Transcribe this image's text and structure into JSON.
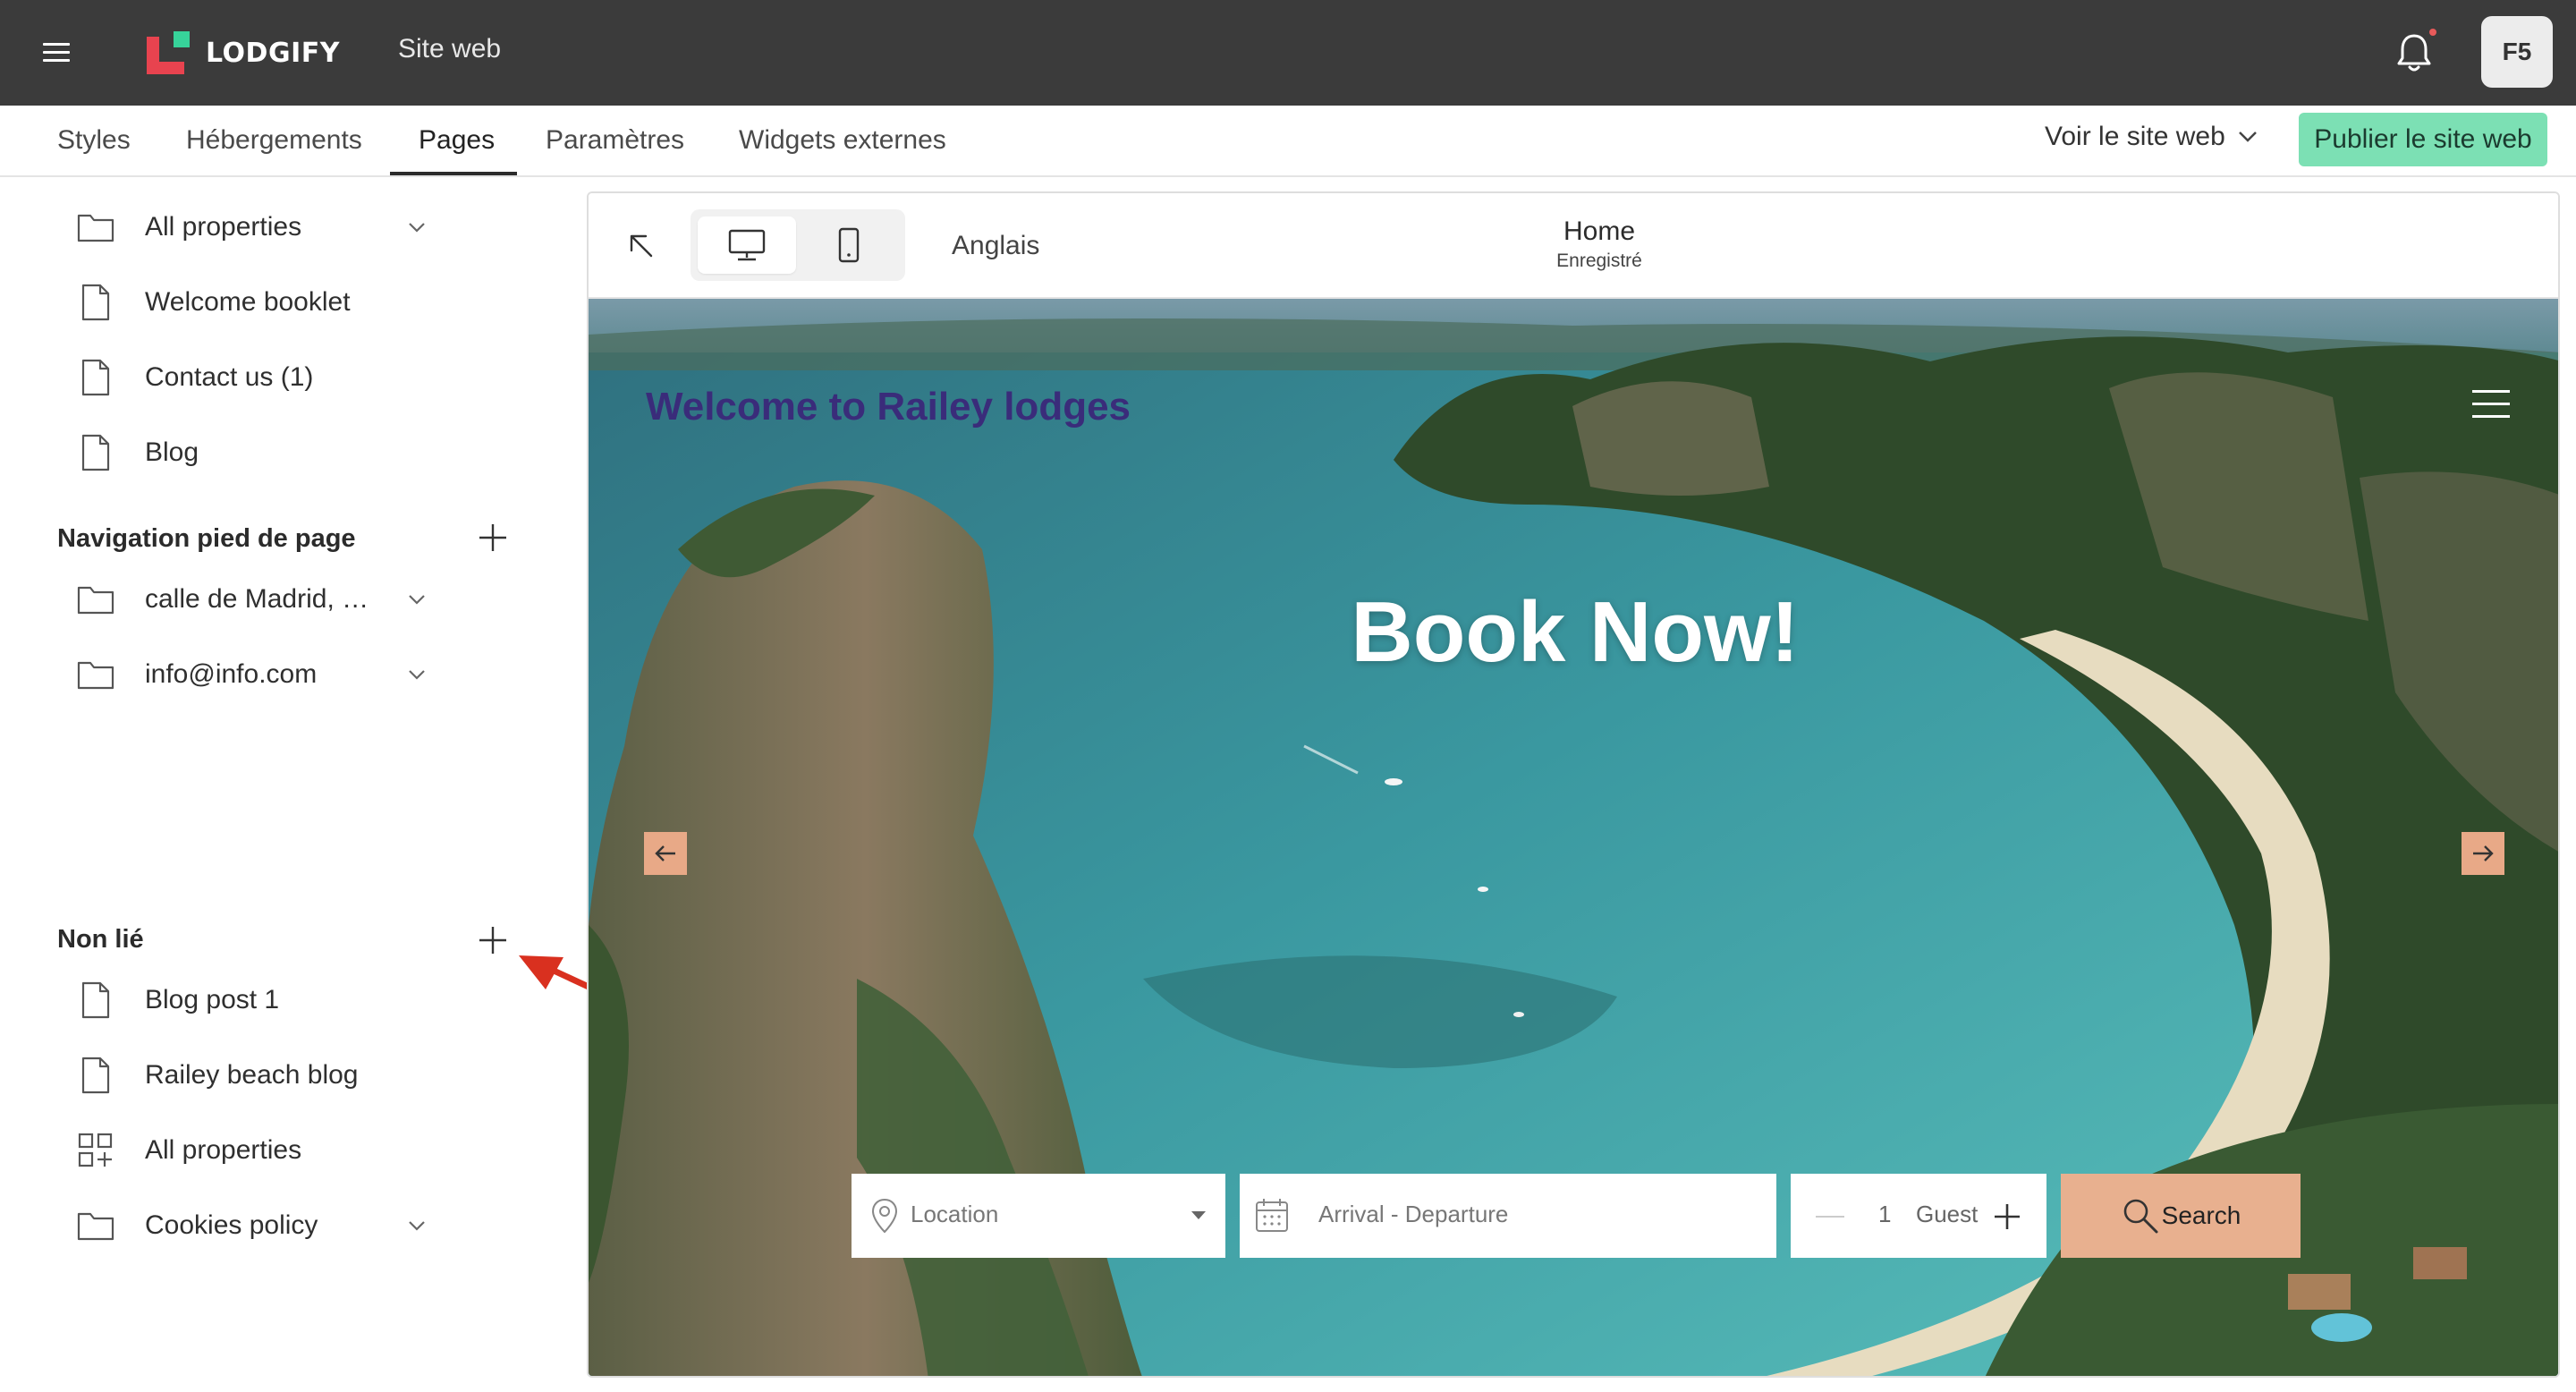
{
  "topbar": {
    "brand": "LODGIFY",
    "section": "Site web",
    "avatar_initials": "F5",
    "brand_colors": {
      "logo_red": "#e8434f",
      "logo_green": "#37d39a",
      "bar": "#3b3b3b"
    }
  },
  "nav": {
    "tabs": [
      {
        "label": "Styles"
      },
      {
        "label": "Hébergements"
      },
      {
        "label": "Pages",
        "active": true
      },
      {
        "label": "Paramètres"
      },
      {
        "label": "Widgets externes"
      }
    ],
    "view_site_label": "Voir le site web",
    "publish_label": "Publier le site web",
    "publish_color": "#7ce0b4"
  },
  "sidebar": {
    "main_items": [
      {
        "label": "All properties",
        "icon": "folder-icon",
        "expandable": true
      },
      {
        "label": "Welcome booklet",
        "icon": "page-icon"
      },
      {
        "label": "Contact us (1)",
        "icon": "page-icon"
      },
      {
        "label": "Blog",
        "icon": "page-icon"
      }
    ],
    "footer_heading": "Navigation pied de page",
    "footer_items": [
      {
        "label": "calle de Madrid, …",
        "icon": "folder-icon",
        "expandable": true
      },
      {
        "label": "info@info.com",
        "icon": "folder-icon",
        "expandable": true
      }
    ],
    "unlinked_heading": "Non lié",
    "unlinked_items": [
      {
        "label": "Blog post 1",
        "icon": "page-icon"
      },
      {
        "label": "Railey beach blog",
        "icon": "page-icon"
      },
      {
        "label": "All properties",
        "icon": "grid-add-icon"
      },
      {
        "label": "Cookies policy",
        "icon": "folder-icon",
        "expandable": true
      }
    ]
  },
  "preview": {
    "language": "Anglais",
    "page_name": "Home",
    "page_status": "Enregistré",
    "active_device": "desktop",
    "hero": {
      "site_title": "Welcome to Railey lodges",
      "headline": "Book Now!",
      "accent_color": "#e8a987"
    },
    "booking": {
      "location_placeholder": "Location",
      "dates_placeholder": "Arrival - Departure",
      "guest_count": "1",
      "guest_label": "Guest",
      "search_label": "Search"
    }
  }
}
